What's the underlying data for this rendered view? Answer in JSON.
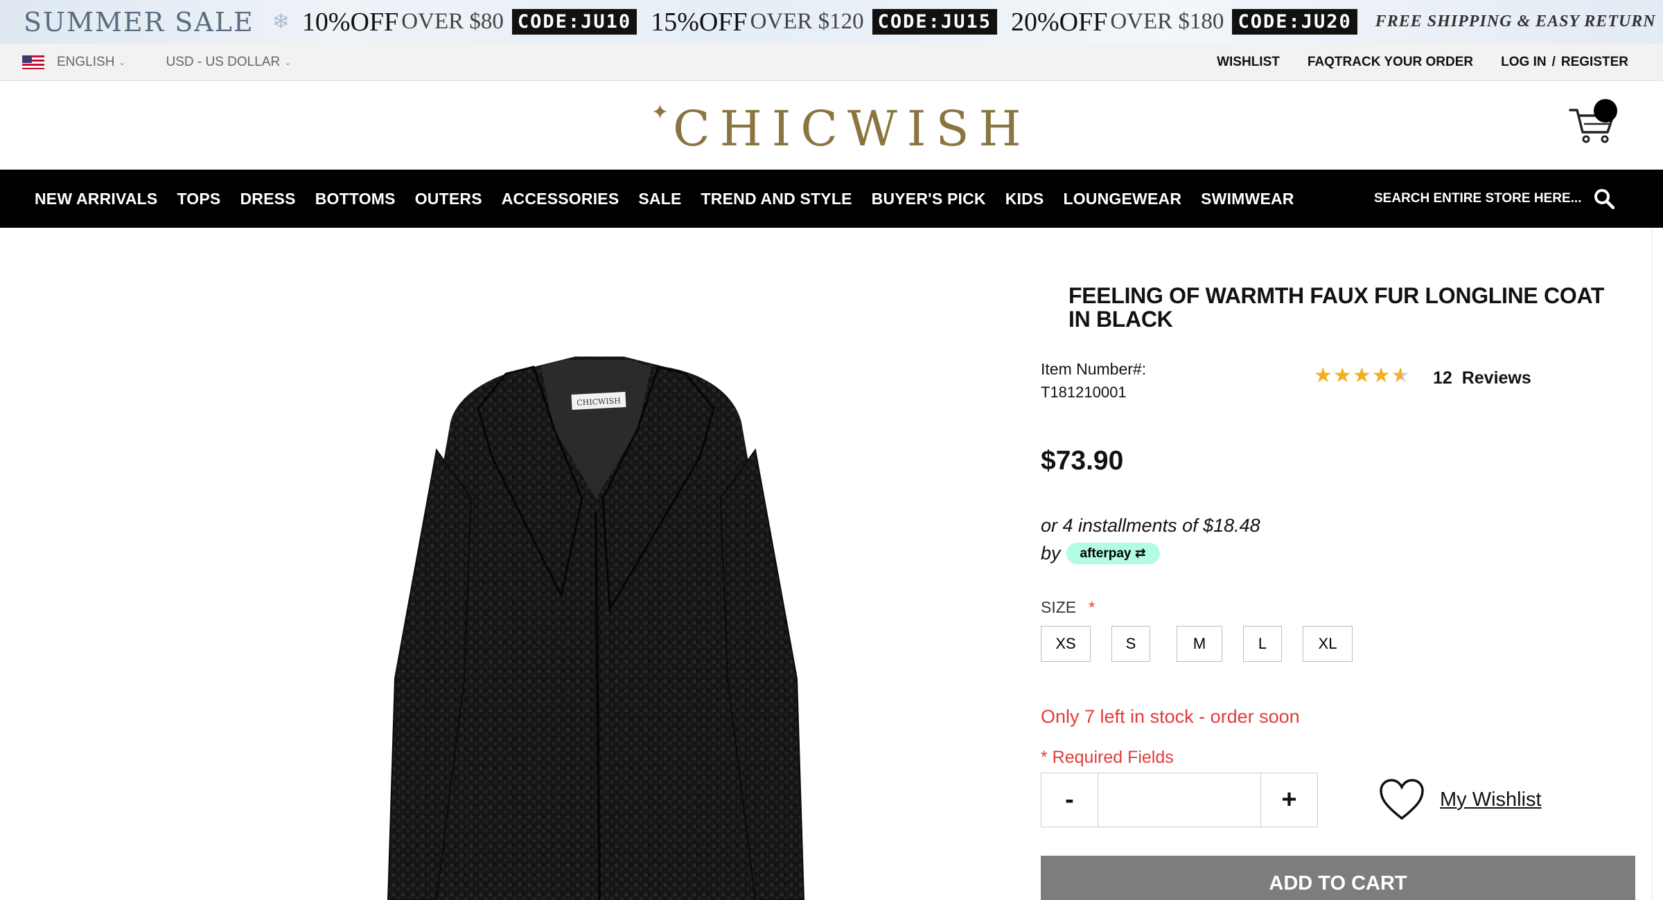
{
  "promo": {
    "sale_title": "SUMMER SALE",
    "offers": [
      {
        "discount": "10%OFF",
        "threshold": "OVER $80",
        "code": "CODE:JU10"
      },
      {
        "discount": "15%OFF",
        "threshold": "OVER $120",
        "code": "CODE:JU15"
      },
      {
        "discount": "20%OFF",
        "threshold": "OVER $180",
        "code": "CODE:JU20"
      }
    ],
    "shipping": "FREE SHIPPING & EASY RETURN"
  },
  "utility": {
    "language": "ENGLISH",
    "currency": "USD - US DOLLAR",
    "wishlist": "WISHLIST",
    "faq": "FAQ",
    "track": "TRACK YOUR ORDER",
    "login": "LOG IN",
    "separator": "/",
    "register": "REGISTER"
  },
  "header": {
    "logo": "CHICWISH",
    "cart_icon": "shopping-cart-icon"
  },
  "nav": {
    "items": [
      "NEW ARRIVALS",
      "TOPS",
      "DRESS",
      "BOTTOMS",
      "OUTERS",
      "ACCESSORIES",
      "SALE",
      "TREND AND STYLE",
      "BUYER'S PICK",
      "KIDS",
      "LOUNGEWEAR",
      "SWIMWEAR"
    ],
    "search_placeholder": "SEARCH ENTIRE STORE HERE...",
    "search_icon": "search-icon"
  },
  "product": {
    "title": "FEELING OF WARMTH FAUX FUR LONGLINE COAT IN BLACK",
    "item_number_label": "Item Number#:",
    "item_number": "T181210001",
    "rating": 4.5,
    "rating_max": 5,
    "review_count": "12",
    "reviews_label": "Reviews",
    "price": "$73.90",
    "installments": "or 4 installments of $18.48",
    "by": "by",
    "afterpay": "afterpay",
    "size_label": "SIZE",
    "required_mark": "*",
    "sizes": [
      "XS",
      "S",
      "M",
      "L",
      "XL"
    ],
    "stock_message": "Only 7 left in stock - order soon",
    "required_fields": "* Required Fields",
    "qty_minus": "-",
    "qty_plus": "+",
    "qty_value": "",
    "wishlist": "My Wishlist",
    "add_to_cart": "ADD TO CART",
    "coat_label": "CHICWISH"
  },
  "colors": {
    "accent_red": "#e23b3b",
    "nav_bg": "#000000",
    "logo_gold": "#8a7440",
    "afterpay_mint": "#b2fce4",
    "button_gray": "#7d7d7d"
  }
}
